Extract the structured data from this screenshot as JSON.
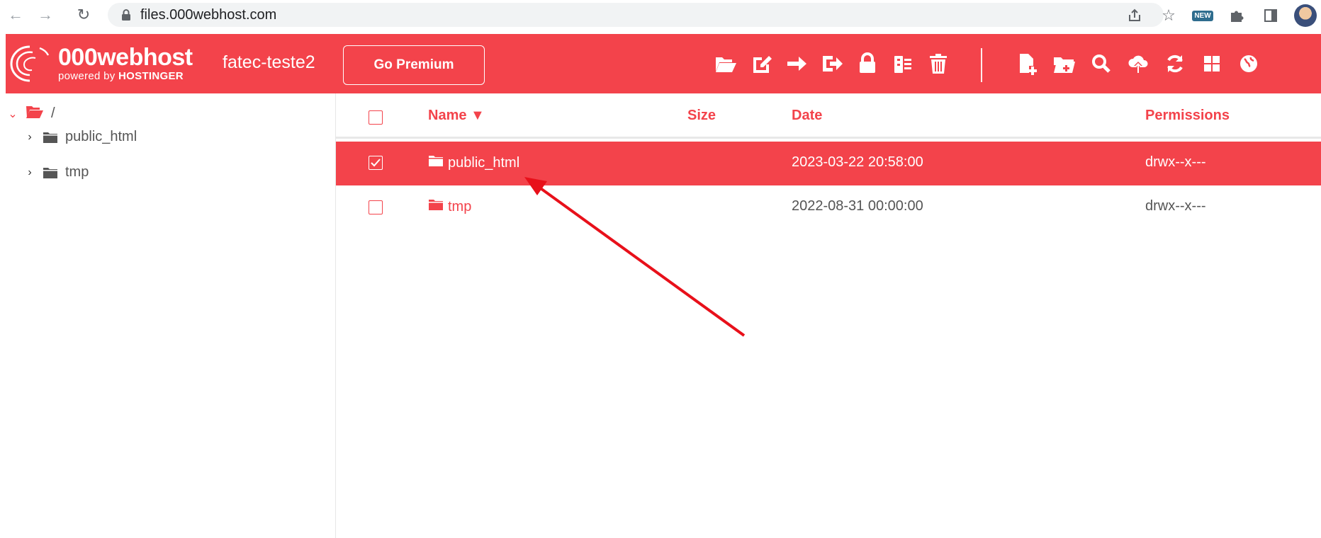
{
  "browser": {
    "url": "files.000webhost.com",
    "new_badge": "NEW"
  },
  "header": {
    "logo_main": "000webhost",
    "logo_sub_prefix": "powered by ",
    "logo_sub_brand": "HOSTINGER",
    "site_name": "fatec-teste2",
    "premium_label": "Go Premium",
    "accent_color": "#f3434b"
  },
  "toolbar": {
    "icons": [
      "folder-open-icon",
      "edit-icon",
      "arrow-right-icon",
      "sign-out-icon",
      "lock-icon",
      "archive-icon",
      "trash-icon",
      "new-file-icon",
      "new-folder-icon",
      "search-icon",
      "upload-cloud-icon",
      "refresh-icon",
      "grid-icon",
      "globe-icon"
    ]
  },
  "sidebar": {
    "root_label": "/",
    "items": [
      {
        "label": "public_html"
      },
      {
        "label": "tmp"
      }
    ]
  },
  "table": {
    "columns": {
      "name": "Name ▼",
      "size": "Size",
      "date": "Date",
      "permissions": "Permissions"
    },
    "rows": [
      {
        "name": "public_html",
        "size": "",
        "date": "2023-03-22 20:58:00",
        "permissions": "drwx--x---",
        "selected": true
      },
      {
        "name": "tmp",
        "size": "",
        "date": "2022-08-31 00:00:00",
        "permissions": "drwx--x---",
        "selected": false
      }
    ]
  },
  "annotation": {
    "arrow_color": "#e8101a"
  }
}
